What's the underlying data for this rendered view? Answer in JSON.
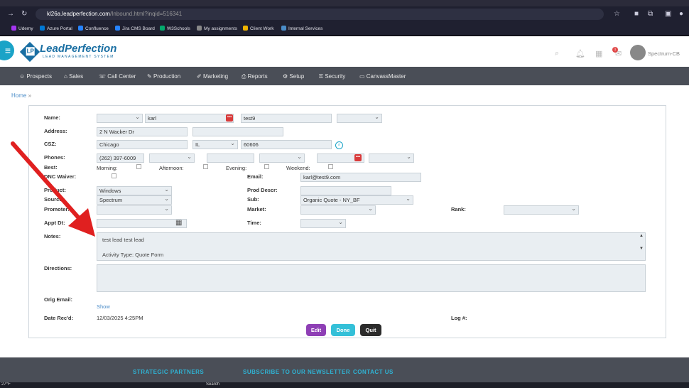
{
  "browser": {
    "url_host": "kl26a.leadperfection.com",
    "url_path": "/Inbound.html?inqid=516341",
    "bookmarks": [
      "Udemy",
      "Azure Portal",
      "Confluence",
      "Jira CMS Board",
      "W3Schools",
      "My assignments",
      "Client Work",
      "Internal Services"
    ]
  },
  "header": {
    "logo_name": "LeadPerfection",
    "logo_tagline": "LEAD MANAGEMENT SYSTEM",
    "notification_count": "1",
    "username": "Spectrum-CB"
  },
  "nav": {
    "items": [
      "Prospects",
      "Sales",
      "Call Center",
      "Production",
      "Marketing",
      "Reports",
      "Setup",
      "Security",
      "CanvassMaster"
    ]
  },
  "breadcrumb": {
    "home": "Home",
    "sep": "»"
  },
  "form": {
    "labels": {
      "name": "Name:",
      "address": "Address:",
      "csz": "CSZ:",
      "phones": "Phones:",
      "best": "Best:",
      "dnc": "DNC Waiver:",
      "email": "Email:",
      "product": "Product:",
      "prod_descr": "Prod Descr:",
      "source": "Source:",
      "sub": "Sub:",
      "promoter": "Promoter:",
      "market": "Market:",
      "rank": "Rank:",
      "appt_dt": "Appt Dt:",
      "time": "Time:",
      "notes": "Notes:",
      "directions": "Directions:",
      "orig_email": "Orig Email:",
      "date_recd": "Date Rec'd:",
      "log": "Log #:"
    },
    "first_name": "karl",
    "last_name": "test9",
    "address1": "2 N Wacker Dr",
    "city": "Chicago",
    "state": "IL",
    "zip": "60606",
    "phone": "(262) 397-6009",
    "best_times": [
      "Morning:",
      "Afternoon:",
      "Evening:",
      "Weekend:"
    ],
    "email": "karl@test9.com",
    "product": "Windows",
    "source": "Spectrum",
    "sub": "Organic Quote - NY_BF",
    "notes_lines": [
      "test lead test lead",
      "Activity Type: Quote Form"
    ],
    "show_link": "Show",
    "date_recd": "12/03/2025 4:25PM"
  },
  "buttons": {
    "edit": "Edit",
    "done": "Done",
    "quit": "Quit"
  },
  "footer": {
    "partners": "STRATEGIC PARTNERS",
    "subscribe": "SUBSCRIBE TO OUR NEWSLETTER",
    "contact": "CONTACT US"
  },
  "taskbar": {
    "temp": "27°F",
    "search": "Search"
  },
  "colors": {
    "accent": "#1aa3c7",
    "nav_bg": "#4a4e57",
    "edit": "#8e3fb5",
    "done": "#34c0d8",
    "quit": "#2b2b2b",
    "arrow": "#e02020"
  }
}
